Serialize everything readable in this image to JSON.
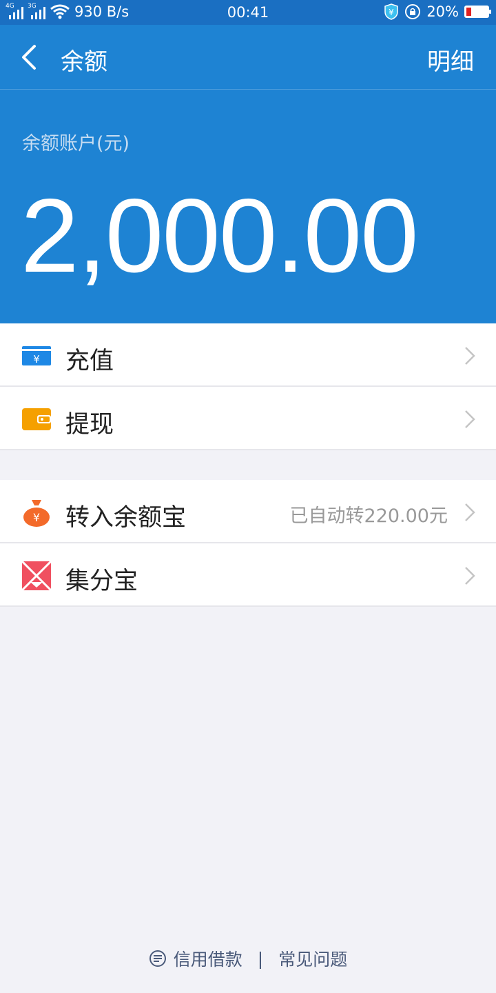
{
  "status_bar": {
    "signal1_label": "4G",
    "signal2_label": "3G",
    "speed": "930 B/s",
    "time": "00:41",
    "battery": "20%",
    "battery_level": 0.2,
    "icons": [
      "signal-icon",
      "wifi-icon",
      "shield-yen-icon",
      "rotation-lock-icon",
      "battery-icon"
    ]
  },
  "nav": {
    "title": "余额",
    "right": "明细"
  },
  "account": {
    "label": "余额账户(元)",
    "amount": "2,000.00"
  },
  "group1": [
    {
      "label": "充值",
      "icon": "recharge-card-icon",
      "color": "#1e88e5"
    },
    {
      "label": "提现",
      "icon": "wallet-icon",
      "color": "#f5a000"
    }
  ],
  "group2": [
    {
      "label": "转入余额宝",
      "extra": "已自动转220.00元",
      "icon": "money-bag-icon",
      "color": "#f36a2a"
    },
    {
      "label": "集分宝",
      "extra": "",
      "icon": "jifenbao-icon",
      "color": "#f05060"
    }
  ],
  "footer": {
    "credit": "信用借款",
    "divider": "|",
    "faq": "常见问题"
  },
  "colors": {
    "primary": "#1e83d3",
    "statusbar": "#1a6fc2",
    "background": "#f2f2f7"
  }
}
